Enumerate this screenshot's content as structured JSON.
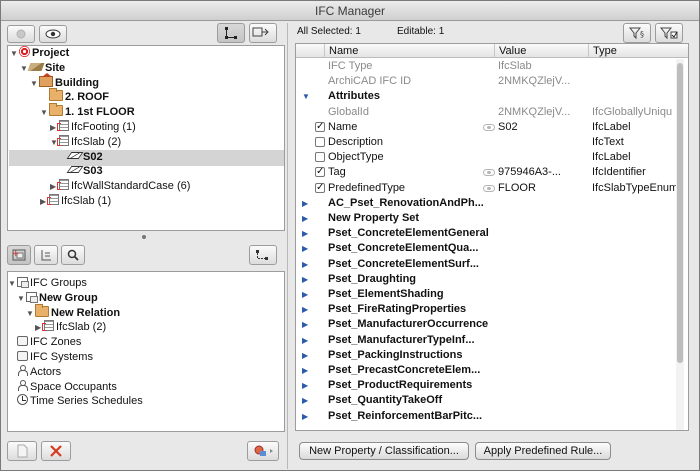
{
  "window": {
    "title": "IFC Manager"
  },
  "toolbar": {
    "selection_info": "All Selected: 1",
    "editable_info": "Editable: 1"
  },
  "model_tree": [
    {
      "label": "Project",
      "icon": "project-icon",
      "indent": 0,
      "bold": true,
      "expanded": true
    },
    {
      "label": "Site",
      "icon": "site-icon",
      "indent": 1,
      "bold": true,
      "expanded": true
    },
    {
      "label": "Building",
      "icon": "building-icon",
      "indent": 2,
      "bold": true,
      "expanded": true
    },
    {
      "label": "2. ROOF",
      "icon": "storey-icon",
      "indent": 3,
      "bold": true,
      "expanded": null
    },
    {
      "label": "1. 1st FLOOR",
      "icon": "storey-icon",
      "indent": 3,
      "bold": true,
      "expanded": true
    },
    {
      "label": "IfcFooting (1)",
      "icon": "element-type-icon",
      "indent": 4,
      "bold": false,
      "expanded": false
    },
    {
      "label": "IfcSlab (2)",
      "icon": "element-type-icon",
      "indent": 4,
      "bold": false,
      "expanded": true
    },
    {
      "label": "S02",
      "icon": "slab-icon",
      "indent": 5,
      "bold": true,
      "expanded": null,
      "selected": true
    },
    {
      "label": "S03",
      "icon": "slab-icon",
      "indent": 5,
      "bold": true,
      "expanded": null
    },
    {
      "label": "IfcWallStandardCase (6)",
      "icon": "element-type-icon",
      "indent": 4,
      "bold": false,
      "expanded": false
    },
    {
      "label": "IfcSlab (1)",
      "icon": "element-type-icon",
      "indent": 3,
      "bold": false,
      "expanded": false
    }
  ],
  "group_tree": [
    {
      "label": "IFC Groups",
      "icon": "groups-icon",
      "indent": 0,
      "bold": false,
      "expanded": true
    },
    {
      "label": "New Group",
      "icon": "group-icon",
      "indent": 1,
      "bold": true,
      "expanded": true
    },
    {
      "label": "New Relation",
      "icon": "folder-icon",
      "indent": 2,
      "bold": true,
      "expanded": true
    },
    {
      "label": "IfcSlab (2)",
      "icon": "element-type-icon",
      "indent": 3,
      "bold": false,
      "expanded": false
    },
    {
      "label": "IFC Zones",
      "icon": "zones-icon",
      "indent": 0,
      "bold": false,
      "expanded": null
    },
    {
      "label": "IFC Systems",
      "icon": "systems-icon",
      "indent": 0,
      "bold": false,
      "expanded": null
    },
    {
      "label": "Actors",
      "icon": "actors-icon",
      "indent": 0,
      "bold": false,
      "expanded": null
    },
    {
      "label": "Space Occupants",
      "icon": "occupants-icon",
      "indent": 0,
      "bold": false,
      "expanded": null
    },
    {
      "label": "Time Series Schedules",
      "icon": "schedule-icon",
      "indent": 0,
      "bold": false,
      "expanded": null
    }
  ],
  "properties": {
    "columns": [
      "Name",
      "Value",
      "Type"
    ],
    "rows": [
      {
        "name": "IFC Type",
        "value": "IfcSlab",
        "type": "",
        "style": "grey",
        "kind": "plain"
      },
      {
        "name": "ArchiCAD IFC ID",
        "value": "2NMKQZlejV...",
        "type": "",
        "style": "grey",
        "kind": "plain"
      },
      {
        "name": "Attributes",
        "value": "",
        "type": "",
        "style": "bold",
        "kind": "group-open"
      },
      {
        "name": "GlobalId",
        "value": "2NMKQZlejV...",
        "type": "IfcGloballyUniqu",
        "style": "grey",
        "kind": "plain"
      },
      {
        "name": "Name",
        "value": "S02",
        "type": "IfcLabel",
        "style": "normal",
        "kind": "checked",
        "lock": true
      },
      {
        "name": "Description",
        "value": "",
        "type": "IfcText",
        "style": "normal",
        "kind": "unchecked"
      },
      {
        "name": "ObjectType",
        "value": "",
        "type": "IfcLabel",
        "style": "normal",
        "kind": "unchecked"
      },
      {
        "name": "Tag",
        "value": "975946A3-...",
        "type": "IfcIdentifier",
        "style": "normal",
        "kind": "checked",
        "lock": true
      },
      {
        "name": "PredefinedType",
        "value": "FLOOR",
        "type": "IfcSlabTypeEnum",
        "style": "normal",
        "kind": "checked",
        "lock": true
      },
      {
        "name": "AC_Pset_RenovationAndPh...",
        "value": "",
        "type": "",
        "style": "bold",
        "kind": "group"
      },
      {
        "name": "New Property Set",
        "value": "",
        "type": "",
        "style": "bold",
        "kind": "group"
      },
      {
        "name": "Pset_ConcreteElementGeneral",
        "value": "",
        "type": "",
        "style": "bold",
        "kind": "group"
      },
      {
        "name": "Pset_ConcreteElementQua...",
        "value": "",
        "type": "",
        "style": "bold",
        "kind": "group"
      },
      {
        "name": "Pset_ConcreteElementSurf...",
        "value": "",
        "type": "",
        "style": "bold",
        "kind": "group"
      },
      {
        "name": "Pset_Draughting",
        "value": "",
        "type": "",
        "style": "bold",
        "kind": "group"
      },
      {
        "name": "Pset_ElementShading",
        "value": "",
        "type": "",
        "style": "bold",
        "kind": "group"
      },
      {
        "name": "Pset_FireRatingProperties",
        "value": "",
        "type": "",
        "style": "bold",
        "kind": "group"
      },
      {
        "name": "Pset_ManufacturerOccurrence",
        "value": "",
        "type": "",
        "style": "bold",
        "kind": "group"
      },
      {
        "name": "Pset_ManufacturerTypeInf...",
        "value": "",
        "type": "",
        "style": "bold",
        "kind": "group"
      },
      {
        "name": "Pset_PackingInstructions",
        "value": "",
        "type": "",
        "style": "bold",
        "kind": "group"
      },
      {
        "name": "Pset_PrecastConcreteElem...",
        "value": "",
        "type": "",
        "style": "bold",
        "kind": "group"
      },
      {
        "name": "Pset_ProductRequirements",
        "value": "",
        "type": "",
        "style": "bold",
        "kind": "group"
      },
      {
        "name": "Pset_QuantityTakeOff",
        "value": "",
        "type": "",
        "style": "bold",
        "kind": "group"
      },
      {
        "name": "Pset_ReinforcementBarPitc...",
        "value": "",
        "type": "",
        "style": "bold",
        "kind": "group"
      }
    ]
  },
  "buttons": {
    "new_property": "New Property / Classification...",
    "apply_rule": "Apply Predefined Rule..."
  }
}
